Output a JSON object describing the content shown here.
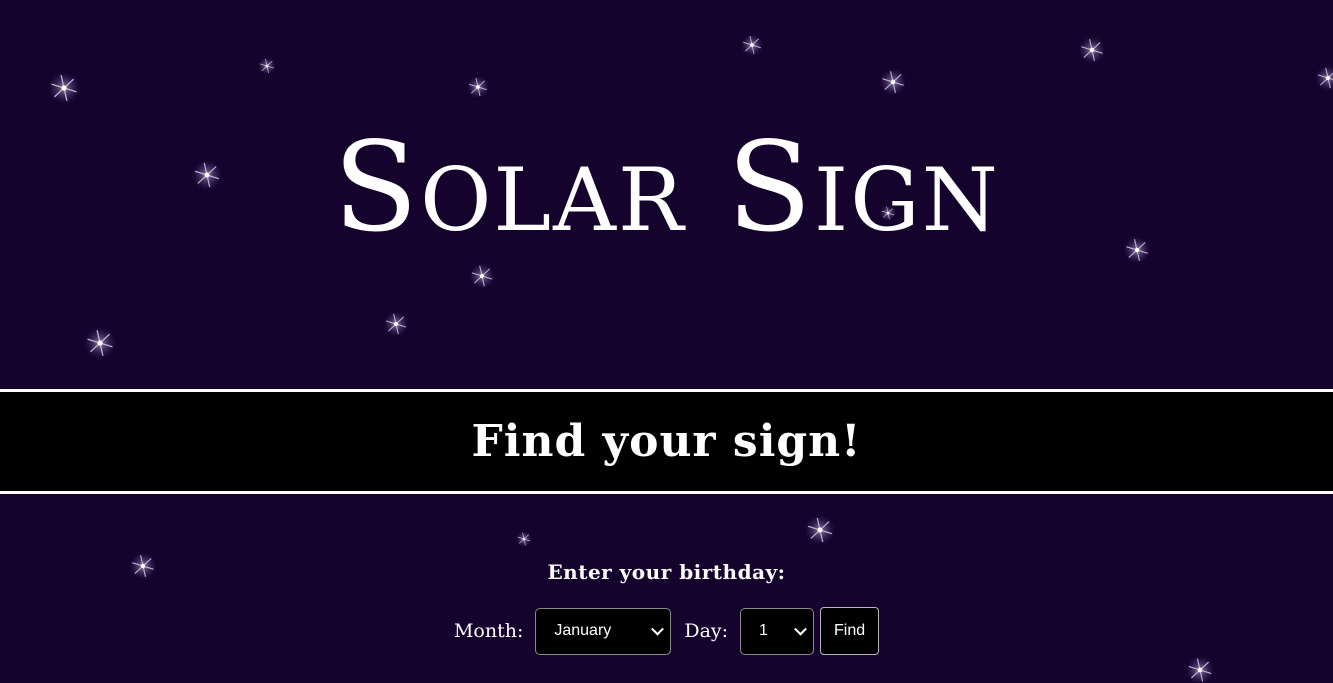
{
  "site": {
    "title": "Solar Sign",
    "banner_heading": "Find your sign!"
  },
  "form": {
    "prompt": "Enter your birthday:",
    "month_label": "Month:",
    "month_value": "January",
    "day_label": "Day:",
    "day_value": "1",
    "find_label": "Find"
  },
  "colors": {
    "background": "#15032e",
    "banner": "#000000",
    "text": "#ffffff"
  },
  "icons": {
    "dropdown": "chevron-down-icon",
    "decoration": "sparkle-star-icon"
  }
}
